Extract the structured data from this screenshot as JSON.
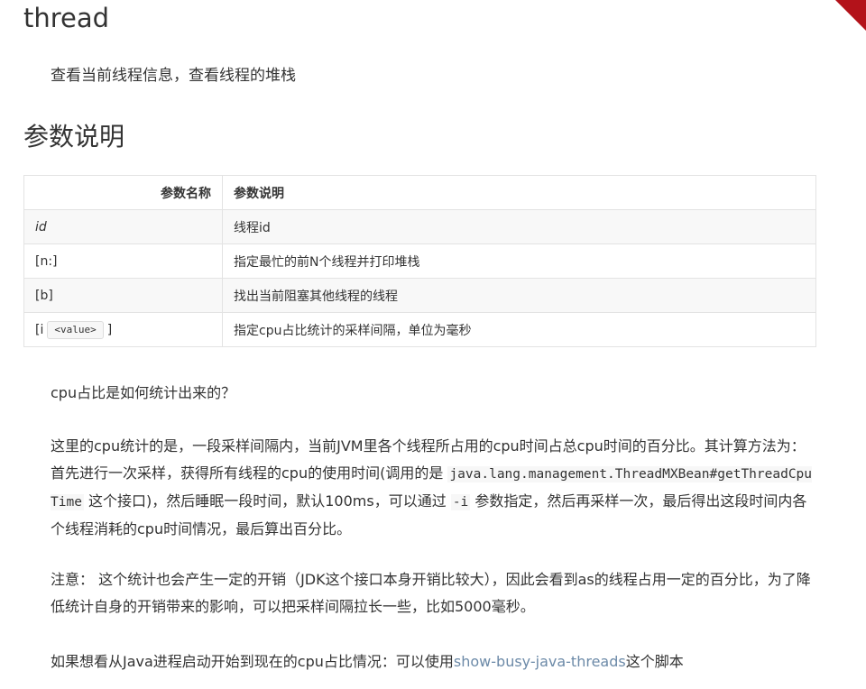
{
  "title": "thread",
  "summary": "查看当前线程信息，查看线程的堆栈",
  "section_title": "参数说明",
  "table": {
    "headers": [
      "参数名称",
      "参数说明"
    ],
    "rows": [
      {
        "name": "id",
        "desc": "线程id"
      },
      {
        "name": "[n:]",
        "desc": "指定最忙的前N个线程并打印堆栈"
      },
      {
        "name": "[b]",
        "desc": "找出当前阻塞其他线程的线程"
      },
      {
        "name_prefix": "[i",
        "name_code": "<value>",
        "name_suffix": "]",
        "desc": "指定cpu占比统计的采样间隔，单位为毫秒"
      }
    ]
  },
  "content": {
    "question": "cpu占比是如何统计出来的？",
    "para2_a": "这里的cpu统计的是，一段采样间隔内，当前JVM里各个线程所占用的cpu时间占总cpu时间的百分比。其计算方法为： 首先进行一次采样，获得所有线程的cpu的使用时间(调用的是 ",
    "para2_code1": "java.lang.management.ThreadMXBean#getThreadCpuTime",
    "para2_b": " 这个接口)，然后睡眠一段时间，默认100ms，可以通过 ",
    "para2_code2": "-i",
    "para2_c": " 参数指定，然后再采样一次，最后得出这段时间内各个线程消耗的cpu时间情况，最后算出百分比。",
    "para3": "注意： 这个统计也会产生一定的开销（JDK这个接口本身开销比较大），因此会看到as的线程占用一定的百分比，为了降低统计自身的开销带来的影响，可以把采样间隔拉长一些，比如5000毫秒。",
    "para4_a": "如果想看从Java进程启动开始到现在的cpu占比情况：可以使用",
    "para4_link": "show-busy-java-threads",
    "para4_b": "这个脚本"
  },
  "colors": {
    "ribbon": "#b3121a",
    "link": "#6c8aa8",
    "text": "#333333"
  }
}
